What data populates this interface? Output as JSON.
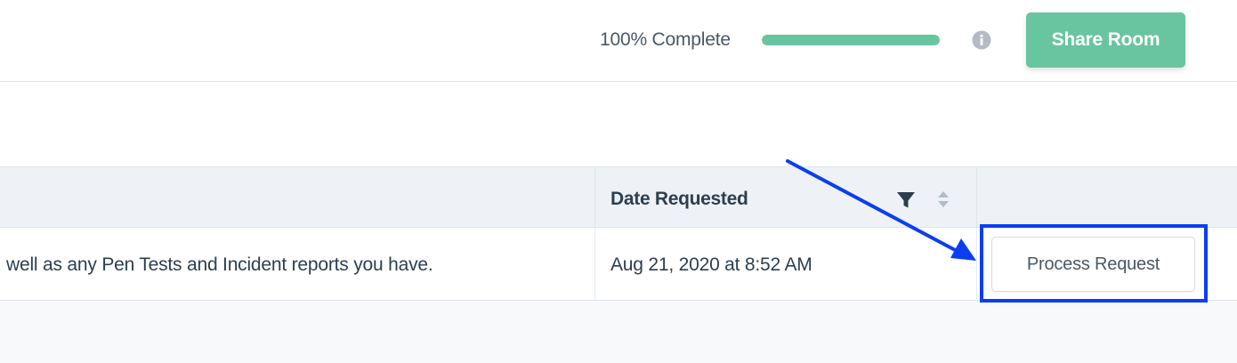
{
  "header": {
    "progress_label": "100% Complete",
    "progress_fraction": 1.0,
    "info_icon": "info-circle-icon",
    "share_button_label": "Share Room"
  },
  "table": {
    "columns": [
      "",
      "Date Requested",
      ""
    ],
    "rows": [
      {
        "description": "well as any Pen Tests and Incident reports you have.",
        "date_requested": "Aug 21, 2020 at 8:52 AM",
        "action_label": "Process Request"
      }
    ],
    "header_icons": [
      "filter-icon",
      "sort-icon"
    ]
  },
  "annotation": {
    "target": "Process Request",
    "color": "#0a3ef0"
  },
  "colors": {
    "accent": "#68c5a0",
    "text": "#2d3e50",
    "annotation": "#0a3ef0"
  }
}
